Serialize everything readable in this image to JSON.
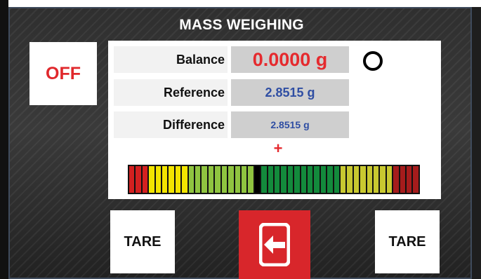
{
  "header": {
    "title": "MASS WEIGHING"
  },
  "power_button": {
    "label": "OFF",
    "color": "#e0282c"
  },
  "readings": {
    "balance": {
      "label": "Balance",
      "value": "0.0000 g",
      "color": "#e52a2e"
    },
    "reference": {
      "label": "Reference",
      "value": "2.8515 g",
      "color": "#2f4ea3"
    },
    "difference": {
      "label": "Difference",
      "value": "2.8515 g",
      "color": "#2f4ea3"
    }
  },
  "status_indicator": {
    "icon": "circle-outline-icon",
    "state": "open"
  },
  "deviation": {
    "sign": "+",
    "segment_colors": [
      "#d42020",
      "#d42020",
      "#d42020",
      "#f2e400",
      "#f2e400",
      "#f2e400",
      "#f2e400",
      "#f2e400",
      "#f2e400",
      "#8fc440",
      "#8fc440",
      "#8fc440",
      "#8fc440",
      "#8fc440",
      "#8fc440",
      "#8fc440",
      "#8fc440",
      "#8fc440",
      "#8fc440",
      "#000000",
      "#138a3c",
      "#138a3c",
      "#138a3c",
      "#138a3c",
      "#138a3c",
      "#138a3c",
      "#138a3c",
      "#138a3c",
      "#138a3c",
      "#138a3c",
      "#138a3c",
      "#138a3c",
      "#c8c830",
      "#c8c830",
      "#c8c830",
      "#c8c830",
      "#c8c830",
      "#c8c830",
      "#c8c830",
      "#c8c830",
      "#a51c1c",
      "#a51c1c",
      "#a51c1c",
      "#a51c1c"
    ]
  },
  "controls": {
    "tare_left": {
      "label": "TARE"
    },
    "exit": {
      "icon": "exit-arrow-icon",
      "color": "#d8262b"
    },
    "tare_right": {
      "label": "TARE"
    }
  }
}
